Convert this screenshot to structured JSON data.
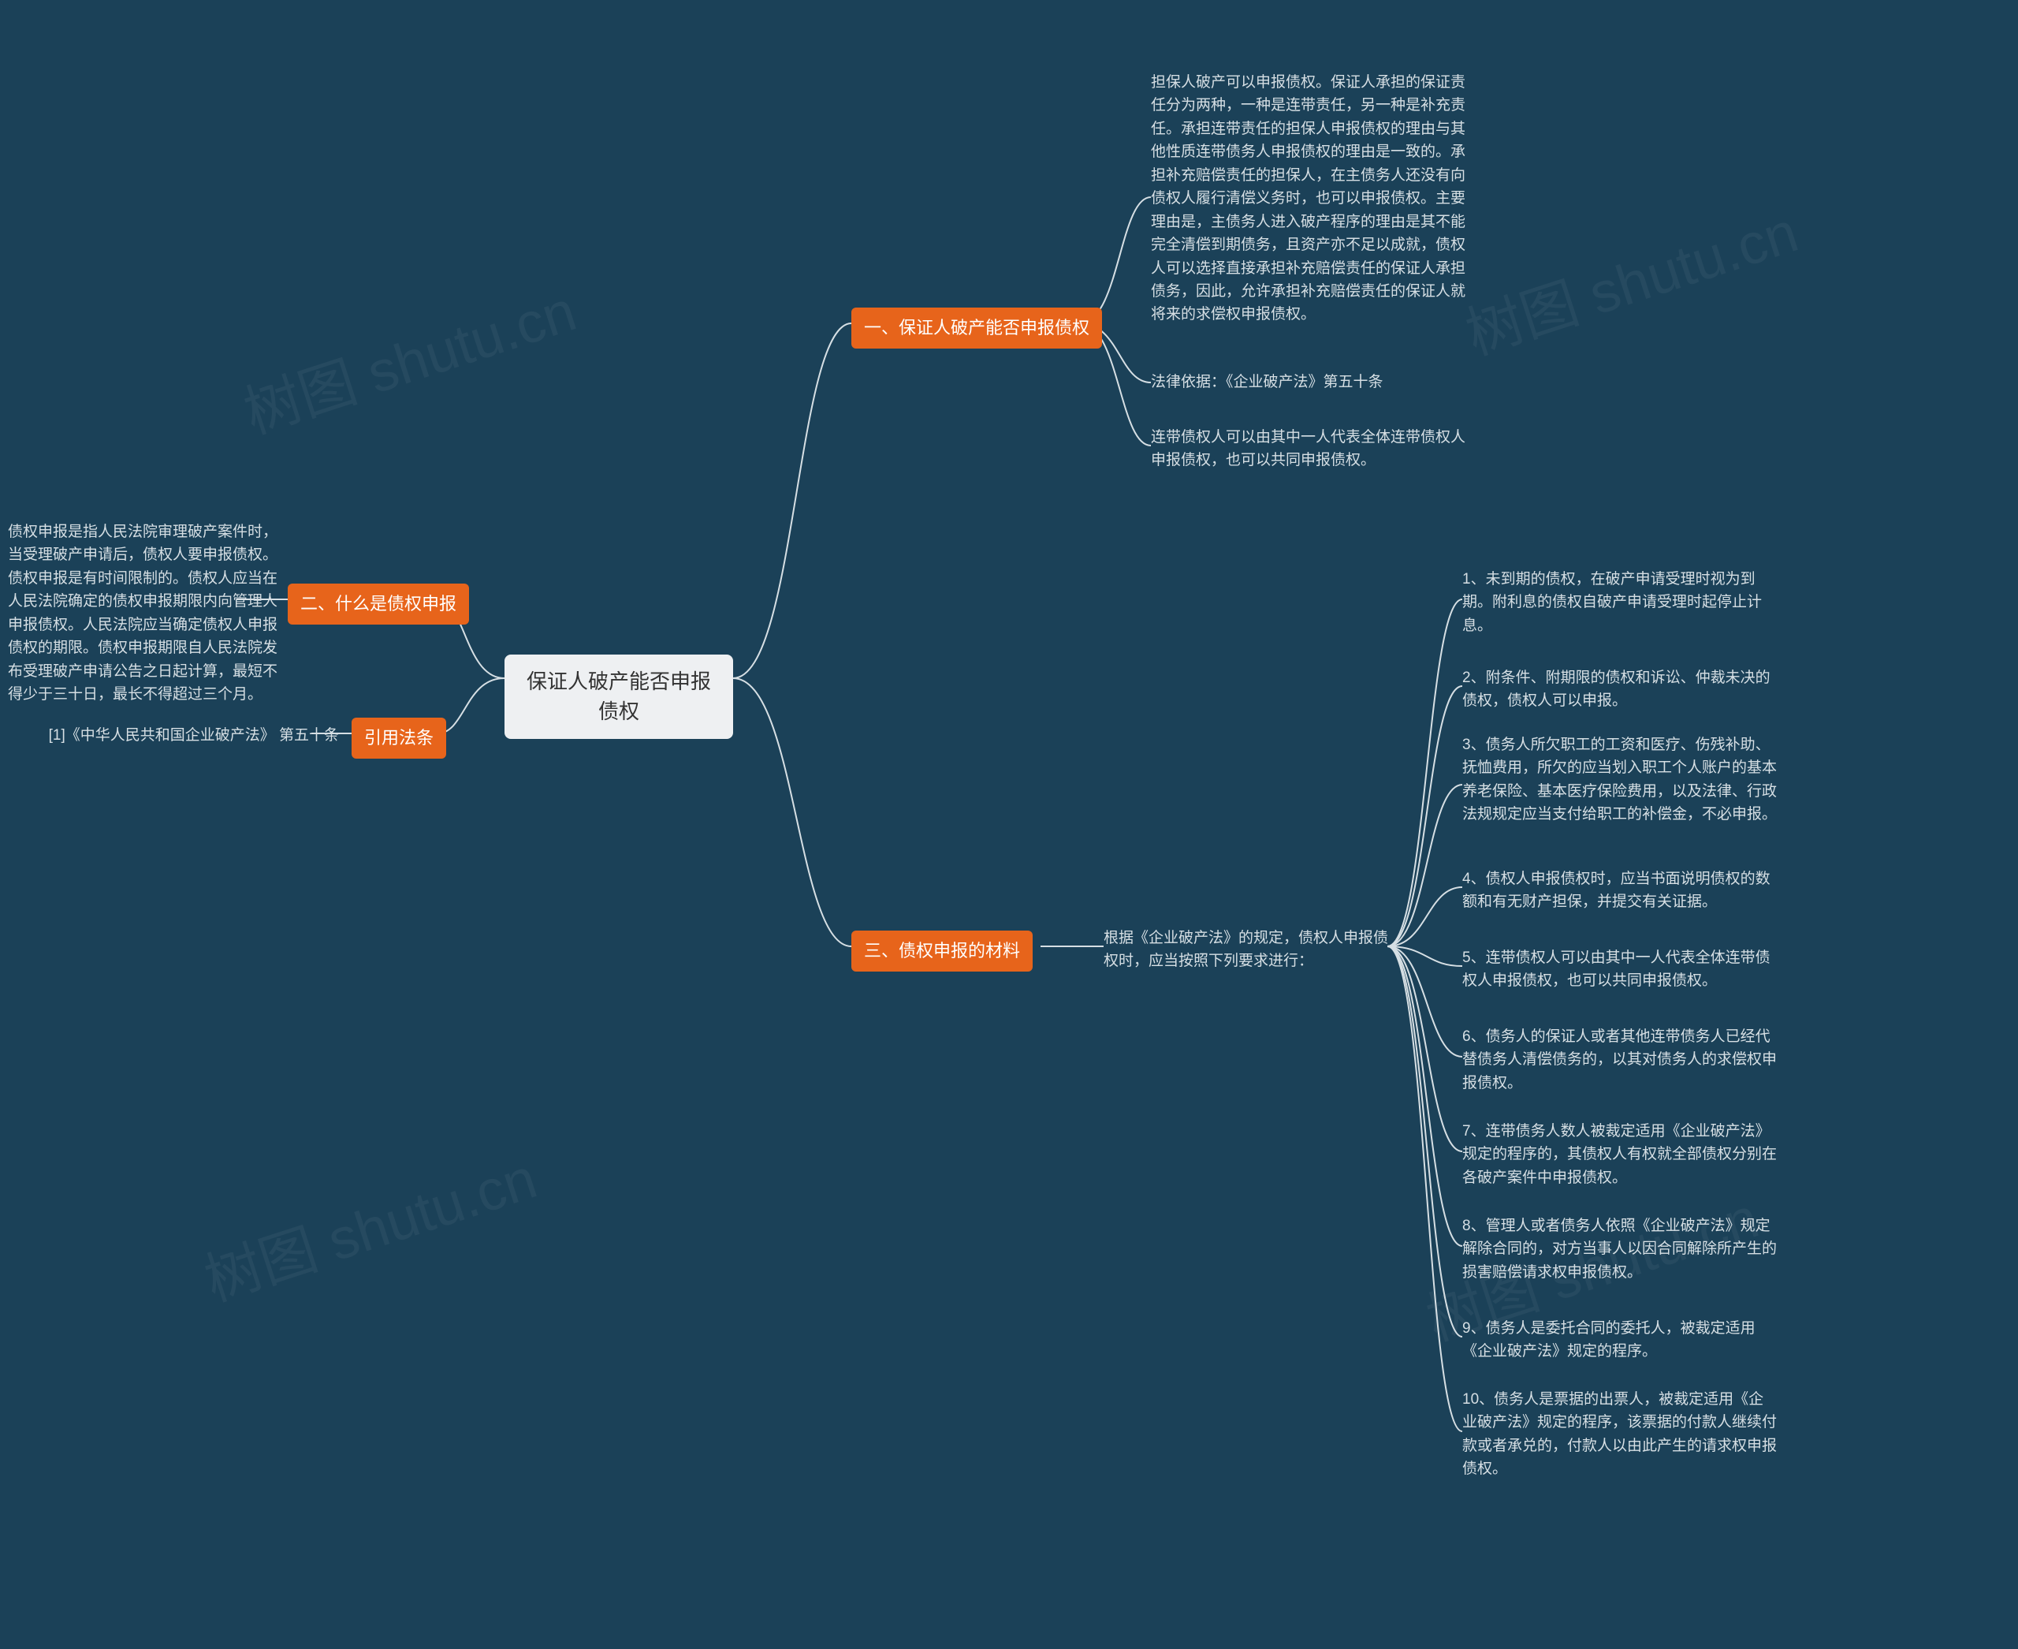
{
  "root": {
    "title": "保证人破产能否申报债权"
  },
  "section1": {
    "title": "一、保证人破产能否申报债权",
    "para1": "担保人破产可以申报债权。保证人承担的保证责任分为两种，一种是连带责任，另一种是补充责任。承担连带责任的担保人申报债权的理由与其他性质连带债务人申报债权的理由是一致的。承担补充赔偿责任的担保人，在主债务人还没有向债权人履行清偿义务时，也可以申报债权。主要理由是，主债务人进入破产程序的理由是其不能完全清偿到期债务，且资产亦不足以成就，债权人可以选择直接承担补充赔偿责任的保证人承担债务，因此，允许承担补充赔偿责任的保证人就将来的求偿权申报债权。",
    "para2": "法律依据：《企业破产法》第五十条",
    "para3": "连带债权人可以由其中一人代表全体连带债权人申报债权，也可以共同申报债权。"
  },
  "section2": {
    "title": "二、什么是债权申报",
    "para": "债权申报是指人民法院审理破产案件时，当受理破产申请后，债权人要申报债权。债权申报是有时间限制的。债权人应当在人民法院确定的债权申报期限内向管理人申报债权。人民法院应当确定债权人申报债权的期限。债权申报期限自人民法院发布受理破产申请公告之日起计算，最短不得少于三十日，最长不得超过三个月。"
  },
  "section3": {
    "title": "三、债权申报的材料",
    "intro": "根据《企业破产法》的规定，债权人申报债权时，应当按照下列要求进行：",
    "items": {
      "i1": "1、未到期的债权，在破产申请受理时视为到期。附利息的债权自破产申请受理时起停止计息。",
      "i2": "2、附条件、附期限的债权和诉讼、仲裁未决的债权，债权人可以申报。",
      "i3": "3、债务人所欠职工的工资和医疗、伤残补助、抚恤费用，所欠的应当划入职工个人账户的基本养老保险、基本医疗保险费用，以及法律、行政法规规定应当支付给职工的补偿金，不必申报。",
      "i4": "4、债权人申报债权时，应当书面说明债权的数额和有无财产担保，并提交有关证据。",
      "i5": "5、连带债权人可以由其中一人代表全体连带债权人申报债权，也可以共同申报债权。",
      "i6": "6、债务人的保证人或者其他连带债务人已经代替债务人清偿债务的，以其对债务人的求偿权申报债权。",
      "i7": "7、连带债务人数人被裁定适用《企业破产法》规定的程序的，其债权人有权就全部债权分别在各破产案件中申报债权。",
      "i8": "8、管理人或者债务人依照《企业破产法》规定解除合同的，对方当事人以因合同解除所产生的损害赔偿请求权申报债权。",
      "i9": "9、债务人是委托合同的委托人，被裁定适用《企业破产法》规定的程序。",
      "i10": "10、债务人是票据的出票人，被裁定适用《企业破产法》规定的程序，该票据的付款人继续付款或者承兑的，付款人以由此产生的请求权申报债权。"
    }
  },
  "laws": {
    "title": "引用法条",
    "item1": "[1]《中华人民共和国企业破产法》 第五十条"
  },
  "watermark": "树图 shutu.cn"
}
